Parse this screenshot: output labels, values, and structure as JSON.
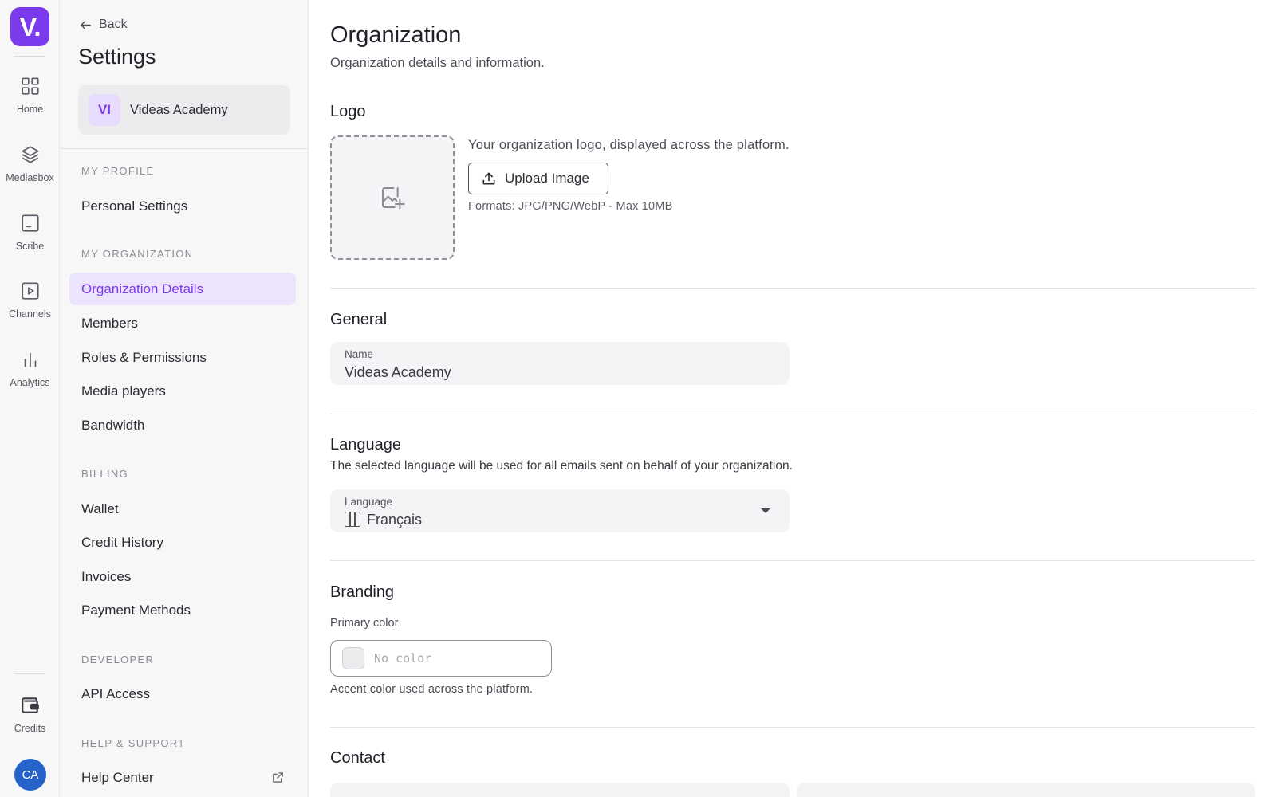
{
  "rail": {
    "logo_text": "V.",
    "items": [
      {
        "label": "Home",
        "icon": "grid-icon"
      },
      {
        "label": "Mediasbox",
        "icon": "layers-icon"
      },
      {
        "label": "Scribe",
        "icon": "caption-icon"
      },
      {
        "label": "Channels",
        "icon": "play-square-icon"
      },
      {
        "label": "Analytics",
        "icon": "bar-chart-icon"
      }
    ],
    "credits_label": "Credits",
    "avatar_initials": "CA"
  },
  "sidebar": {
    "back_label": "Back",
    "title": "Settings",
    "org_badge": "VI",
    "org_name": "Videas Academy",
    "sections": {
      "profile": "MY PROFILE",
      "organization": "MY ORGANIZATION",
      "billing": "BILLING",
      "developer": "DEVELOPER",
      "help": "HELP & SUPPORT"
    },
    "items": {
      "personal_settings": "Personal Settings",
      "organization_details": "Organization Details",
      "members": "Members",
      "roles": "Roles & Permissions",
      "media_players": "Media players",
      "bandwidth": "Bandwidth",
      "wallet": "Wallet",
      "credit_history": "Credit History",
      "invoices": "Invoices",
      "payment_methods": "Payment Methods",
      "api_access": "API Access",
      "help_center": "Help Center"
    }
  },
  "main": {
    "title": "Organization",
    "subtitle": "Organization details and information.",
    "logo": {
      "heading": "Logo",
      "description": "Your organization logo, displayed across the platform.",
      "upload_label": "Upload Image",
      "formats": "Formats: JPG/PNG/WebP - Max 10MB"
    },
    "general": {
      "heading": "General",
      "name_label": "Name",
      "name_value": "Videas Academy"
    },
    "language": {
      "heading": "Language",
      "description": "The selected language will be used for all emails sent on behalf of your organization.",
      "field_label": "Language",
      "selected": "Français"
    },
    "branding": {
      "heading": "Branding",
      "primary_label": "Primary color",
      "placeholder": "No color",
      "description": "Accent color used across the platform."
    },
    "contact": {
      "heading": "Contact"
    }
  },
  "colors": {
    "accent": "#7c3aed",
    "avatar": "#2563c9"
  }
}
